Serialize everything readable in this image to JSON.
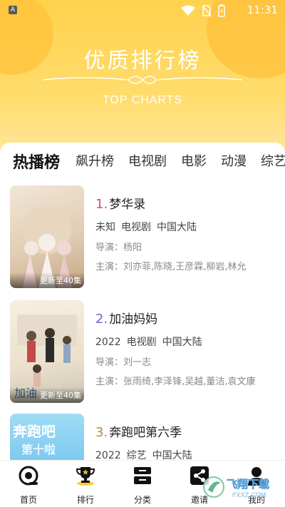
{
  "status_bar": {
    "left_indicator": "A",
    "time": "11:31",
    "icons": [
      "wifi-icon",
      "no-sim-icon",
      "battery-charging-icon"
    ]
  },
  "header": {
    "title": "优质排行榜",
    "subtitle": "TOP CHARTS"
  },
  "tabs": [
    {
      "label": "热播榜",
      "active": true
    },
    {
      "label": "飙升榜",
      "active": false
    },
    {
      "label": "电视剧",
      "active": false
    },
    {
      "label": "电影",
      "active": false
    },
    {
      "label": "动漫",
      "active": false
    },
    {
      "label": "综艺",
      "active": false
    }
  ],
  "items": [
    {
      "rank": "1.",
      "title": "梦华录",
      "year": "未知",
      "genre": "电视剧",
      "region": "中国大陆",
      "director_label": "导演：",
      "director": "杨阳",
      "cast_label": "主演：",
      "cast": "刘亦菲,陈晓,王彦霖,柳岩,林允",
      "badge": "更新至40集",
      "rank_color": "#e8457a",
      "poster_colors": [
        "#e9d9c7",
        "#c9a887"
      ]
    },
    {
      "rank": "2.",
      "title": "加油妈妈",
      "year": "2022",
      "genre": "电视剧",
      "region": "中国大陆",
      "director_label": "导演：",
      "director": "刘一志",
      "cast_label": "主演：",
      "cast": "张雨绮,李泽锋,吴越,董洁,袁文康",
      "badge": "更新至40集",
      "rank_color": "#7b5ad6",
      "poster_colors": [
        "#f2ead9",
        "#a8b7b0"
      ]
    },
    {
      "rank": "3.",
      "title": "奔跑吧第六季",
      "year": "2022",
      "genre": "综艺",
      "region": "中国大陆",
      "rank_color": "#b5884a",
      "poster_colors": [
        "#8fd3f0",
        "#3a95d6"
      ]
    }
  ],
  "bottom_nav": [
    {
      "label": "首页",
      "icon": "home-icon"
    },
    {
      "label": "排行",
      "icon": "trophy-icon"
    },
    {
      "label": "分类",
      "icon": "category-icon"
    },
    {
      "label": "邀请",
      "icon": "share-icon"
    },
    {
      "label": "我的",
      "icon": "user-icon"
    }
  ],
  "watermark": {
    "text": "飞翔下载",
    "domain": "FXXZ.COM"
  }
}
